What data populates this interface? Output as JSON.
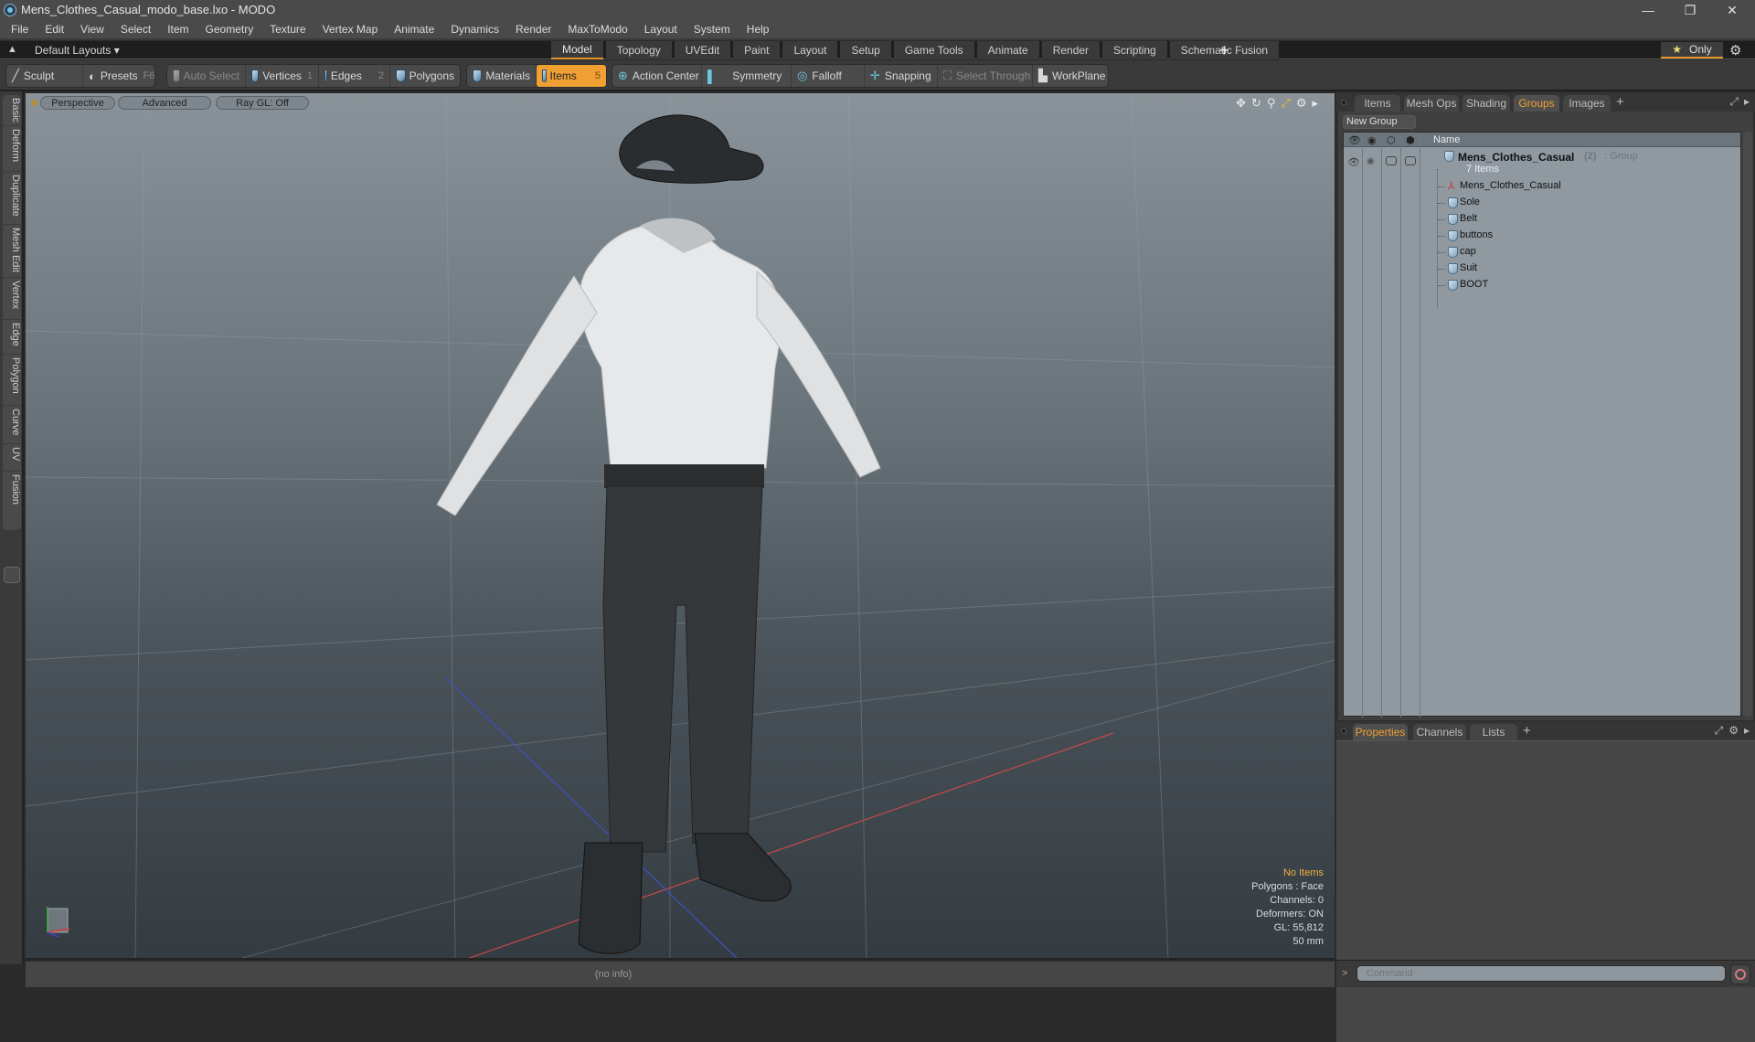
{
  "window": {
    "title": "Mens_Clothes_Casual_modo_base.lxo - MODO",
    "controls": [
      "minimize",
      "restore",
      "close"
    ]
  },
  "menu": [
    "File",
    "Edit",
    "View",
    "Select",
    "Item",
    "Geometry",
    "Texture",
    "Vertex Map",
    "Animate",
    "Dynamics",
    "Render",
    "MaxToModo",
    "Layout",
    "System",
    "Help"
  ],
  "layoutbar": {
    "layout_select": "Default Layouts ▾",
    "tabs": [
      "Model",
      "Topology",
      "UVEdit",
      "Paint",
      "Layout",
      "Setup",
      "Game Tools",
      "Animate",
      "Render",
      "Scripting",
      "Schematic Fusion"
    ],
    "active_tab": "Model",
    "add_tab": "+",
    "only_label": "Only",
    "accent_color": "#e8952c"
  },
  "toolbar": {
    "sculpt": "Sculpt",
    "presets": "Presets",
    "presets_hotkey": "F6",
    "auto_select": "Auto Select",
    "vertices": "Vertices",
    "vertices_hotkey": "1",
    "edges": "Edges",
    "edges_hotkey": "2",
    "polygons": "Polygons",
    "materials": "Materials",
    "items": "Items",
    "items_hotkey": "5",
    "action_center": "Action Center",
    "symmetry": "Symmetry",
    "falloff": "Falloff",
    "snapping": "Snapping",
    "select_through": "Select Through",
    "workplane": "WorkPlane",
    "active_tool": "Items"
  },
  "left_tabs": [
    "Basic",
    "Deform",
    "Duplicate",
    "Mesh Edit",
    "Vertex",
    "Edge",
    "Polygon",
    "Curve",
    "UV",
    "Fusion"
  ],
  "viewport": {
    "view": "Perspective",
    "shading": "Advanced",
    "raygl": "Ray GL: Off",
    "info": {
      "selection": "No Items",
      "polygons": "Polygons : Face",
      "channels": "Channels: 0",
      "deformers": "Deformers: ON",
      "gl": "GL: 55,812",
      "grid": "50 mm"
    }
  },
  "infobar": {
    "text": "(no info)"
  },
  "top_panel": {
    "tabs": [
      "Items",
      "Mesh Ops",
      "Shading",
      "Groups",
      "Images"
    ],
    "active_tab": "Groups",
    "add_tab": "+",
    "new_group_button": "New Group",
    "column_name": "Name",
    "group": {
      "name": "Mens_Clothes_Casual",
      "count": "(2)",
      "type": ": Group",
      "items_label": "7 Items"
    },
    "children": [
      {
        "name": "Mens_Clothes_Casual",
        "icon": "locator-icon"
      },
      {
        "name": "Sole",
        "icon": "mesh-icon"
      },
      {
        "name": "Belt",
        "icon": "mesh-icon"
      },
      {
        "name": "buttons",
        "icon": "mesh-icon"
      },
      {
        "name": "cap",
        "icon": "mesh-icon"
      },
      {
        "name": "Suit",
        "icon": "mesh-icon"
      },
      {
        "name": "BOOT",
        "icon": "mesh-icon"
      }
    ]
  },
  "bottom_panel": {
    "tabs": [
      "Properties",
      "Channels",
      "Lists"
    ],
    "active_tab": "Properties",
    "add_tab": "+"
  },
  "command": {
    "prompt": ">",
    "placeholder": "Command"
  }
}
